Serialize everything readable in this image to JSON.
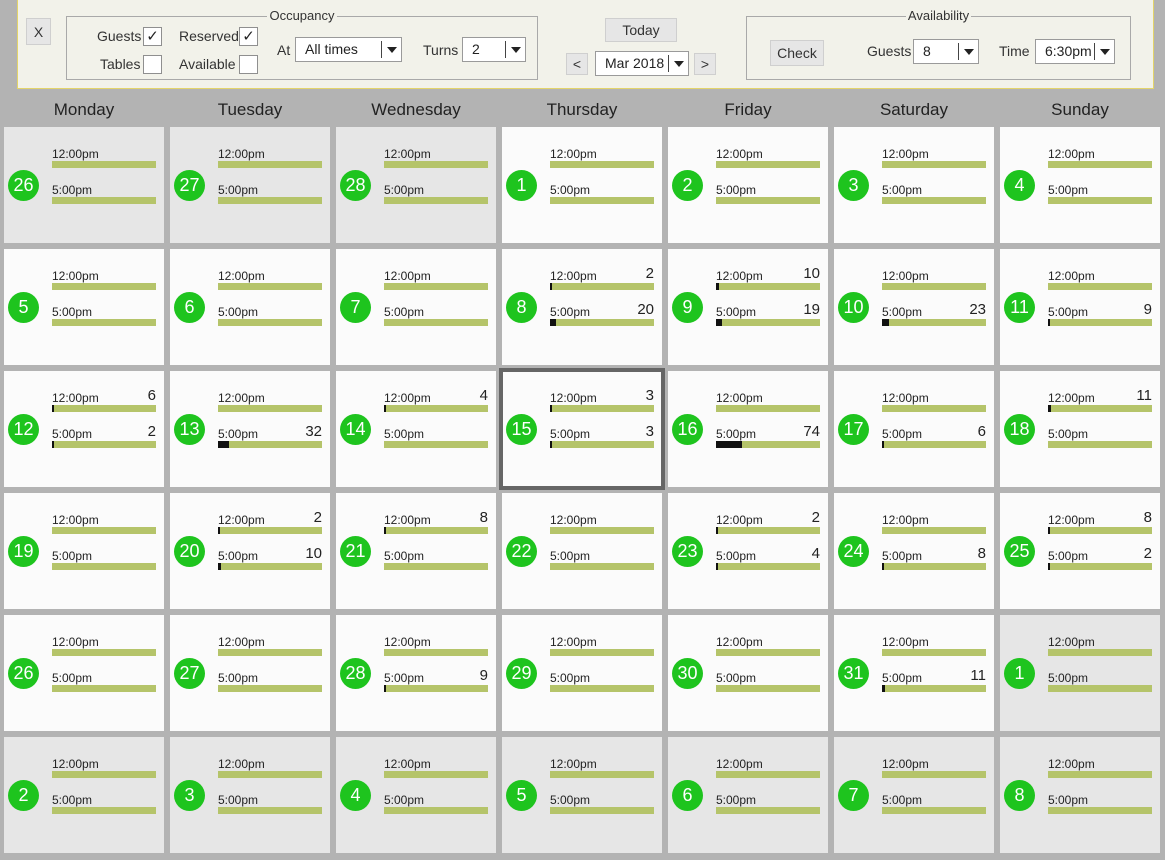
{
  "toolbar": {
    "close_label": "X",
    "occupancy": {
      "title": "Occupancy",
      "guests_label": "Guests",
      "guests_checked": "✓",
      "reserved_label": "Reserved",
      "reserved_checked": "✓",
      "tables_label": "Tables",
      "tables_checked": "",
      "available_label": "Available",
      "available_checked": "",
      "at_label": "At",
      "at_value": "All times",
      "turns_label": "Turns",
      "turns_value": "2"
    },
    "nav": {
      "today_label": "Today",
      "prev_label": "<",
      "next_label": ">",
      "month_value": "Mar 2018"
    },
    "availability": {
      "title": "Availability",
      "check_label": "Check",
      "guests_label": "Guests",
      "guests_value": "8",
      "time_label": "Time",
      "time_value": "6:30pm"
    }
  },
  "calendar": {
    "weekdays": [
      "Monday",
      "Tuesday",
      "Wednesday",
      "Thursday",
      "Friday",
      "Saturday",
      "Sunday"
    ],
    "slot_labels": [
      "12:00pm",
      "5:00pm"
    ],
    "selected_day": "15",
    "weeks": [
      [
        {
          "day": "26",
          "muted": true,
          "slots": [
            {
              "count": "",
              "fill": 0
            },
            {
              "count": "",
              "fill": 0
            }
          ]
        },
        {
          "day": "27",
          "muted": true,
          "slots": [
            {
              "count": "",
              "fill": 0
            },
            {
              "count": "",
              "fill": 0
            }
          ]
        },
        {
          "day": "28",
          "muted": true,
          "slots": [
            {
              "count": "",
              "fill": 0
            },
            {
              "count": "",
              "fill": 0
            }
          ]
        },
        {
          "day": "1",
          "muted": false,
          "slots": [
            {
              "count": "",
              "fill": 0
            },
            {
              "count": "",
              "fill": 0
            }
          ]
        },
        {
          "day": "2",
          "muted": false,
          "slots": [
            {
              "count": "",
              "fill": 0
            },
            {
              "count": "",
              "fill": 0
            }
          ]
        },
        {
          "day": "3",
          "muted": false,
          "slots": [
            {
              "count": "",
              "fill": 0
            },
            {
              "count": "",
              "fill": 0
            }
          ]
        },
        {
          "day": "4",
          "muted": false,
          "slots": [
            {
              "count": "",
              "fill": 0
            },
            {
              "count": "",
              "fill": 0
            }
          ]
        }
      ],
      [
        {
          "day": "5",
          "muted": false,
          "slots": [
            {
              "count": "",
              "fill": 0
            },
            {
              "count": "",
              "fill": 0
            }
          ]
        },
        {
          "day": "6",
          "muted": false,
          "slots": [
            {
              "count": "",
              "fill": 0
            },
            {
              "count": "",
              "fill": 0
            }
          ]
        },
        {
          "day": "7",
          "muted": false,
          "slots": [
            {
              "count": "",
              "fill": 0
            },
            {
              "count": "",
              "fill": 0
            }
          ]
        },
        {
          "day": "8",
          "muted": false,
          "slots": [
            {
              "count": "2",
              "fill": 0.01
            },
            {
              "count": "20",
              "fill": 0.06
            }
          ]
        },
        {
          "day": "9",
          "muted": false,
          "slots": [
            {
              "count": "10",
              "fill": 0.03
            },
            {
              "count": "19",
              "fill": 0.06
            }
          ]
        },
        {
          "day": "10",
          "muted": false,
          "slots": [
            {
              "count": "",
              "fill": 0
            },
            {
              "count": "23",
              "fill": 0.07
            }
          ]
        },
        {
          "day": "11",
          "muted": false,
          "slots": [
            {
              "count": "",
              "fill": 0
            },
            {
              "count": "9",
              "fill": 0.02
            }
          ]
        }
      ],
      [
        {
          "day": "12",
          "muted": false,
          "slots": [
            {
              "count": "6",
              "fill": 0.02
            },
            {
              "count": "2",
              "fill": 0.01
            }
          ]
        },
        {
          "day": "13",
          "muted": false,
          "slots": [
            {
              "count": "",
              "fill": 0
            },
            {
              "count": "32",
              "fill": 0.11
            }
          ]
        },
        {
          "day": "14",
          "muted": false,
          "slots": [
            {
              "count": "4",
              "fill": 0.01
            },
            {
              "count": "",
              "fill": 0
            }
          ]
        },
        {
          "day": "15",
          "muted": false,
          "slots": [
            {
              "count": "3",
              "fill": 0.01
            },
            {
              "count": "3",
              "fill": 0.01
            }
          ]
        },
        {
          "day": "16",
          "muted": false,
          "slots": [
            {
              "count": "",
              "fill": 0
            },
            {
              "count": "74",
              "fill": 0.25
            }
          ]
        },
        {
          "day": "17",
          "muted": false,
          "slots": [
            {
              "count": "",
              "fill": 0
            },
            {
              "count": "6",
              "fill": 0.02
            }
          ]
        },
        {
          "day": "18",
          "muted": false,
          "slots": [
            {
              "count": "11",
              "fill": 0.03
            },
            {
              "count": "",
              "fill": 0
            }
          ]
        }
      ],
      [
        {
          "day": "19",
          "muted": false,
          "slots": [
            {
              "count": "",
              "fill": 0
            },
            {
              "count": "",
              "fill": 0
            }
          ]
        },
        {
          "day": "20",
          "muted": false,
          "slots": [
            {
              "count": "2",
              "fill": 0.01
            },
            {
              "count": "10",
              "fill": 0.03
            }
          ]
        },
        {
          "day": "21",
          "muted": false,
          "slots": [
            {
              "count": "8",
              "fill": 0.02
            },
            {
              "count": "",
              "fill": 0
            }
          ]
        },
        {
          "day": "22",
          "muted": false,
          "slots": [
            {
              "count": "",
              "fill": 0
            },
            {
              "count": "",
              "fill": 0
            }
          ]
        },
        {
          "day": "23",
          "muted": false,
          "slots": [
            {
              "count": "2",
              "fill": 0.01
            },
            {
              "count": "4",
              "fill": 0.01
            }
          ]
        },
        {
          "day": "24",
          "muted": false,
          "slots": [
            {
              "count": "",
              "fill": 0
            },
            {
              "count": "8",
              "fill": 0.02
            }
          ]
        },
        {
          "day": "25",
          "muted": false,
          "slots": [
            {
              "count": "8",
              "fill": 0.02
            },
            {
              "count": "2",
              "fill": 0.01
            }
          ]
        }
      ],
      [
        {
          "day": "26",
          "muted": false,
          "slots": [
            {
              "count": "",
              "fill": 0
            },
            {
              "count": "",
              "fill": 0
            }
          ]
        },
        {
          "day": "27",
          "muted": false,
          "slots": [
            {
              "count": "",
              "fill": 0
            },
            {
              "count": "",
              "fill": 0
            }
          ]
        },
        {
          "day": "28",
          "muted": false,
          "slots": [
            {
              "count": "",
              "fill": 0
            },
            {
              "count": "9",
              "fill": 0.02
            }
          ]
        },
        {
          "day": "29",
          "muted": false,
          "slots": [
            {
              "count": "",
              "fill": 0
            },
            {
              "count": "",
              "fill": 0
            }
          ]
        },
        {
          "day": "30",
          "muted": false,
          "slots": [
            {
              "count": "",
              "fill": 0
            },
            {
              "count": "",
              "fill": 0
            }
          ]
        },
        {
          "day": "31",
          "muted": false,
          "slots": [
            {
              "count": "",
              "fill": 0
            },
            {
              "count": "11",
              "fill": 0.03
            }
          ]
        },
        {
          "day": "1",
          "muted": true,
          "slots": [
            {
              "count": "",
              "fill": 0
            },
            {
              "count": "",
              "fill": 0
            }
          ]
        }
      ],
      [
        {
          "day": "2",
          "muted": true,
          "slots": [
            {
              "count": "",
              "fill": 0
            },
            {
              "count": "",
              "fill": 0
            }
          ]
        },
        {
          "day": "3",
          "muted": true,
          "slots": [
            {
              "count": "",
              "fill": 0
            },
            {
              "count": "",
              "fill": 0
            }
          ]
        },
        {
          "day": "4",
          "muted": true,
          "slots": [
            {
              "count": "",
              "fill": 0
            },
            {
              "count": "",
              "fill": 0
            }
          ]
        },
        {
          "day": "5",
          "muted": true,
          "slots": [
            {
              "count": "",
              "fill": 0
            },
            {
              "count": "",
              "fill": 0
            }
          ]
        },
        {
          "day": "6",
          "muted": true,
          "slots": [
            {
              "count": "",
              "fill": 0
            },
            {
              "count": "",
              "fill": 0
            }
          ]
        },
        {
          "day": "7",
          "muted": true,
          "slots": [
            {
              "count": "",
              "fill": 0
            },
            {
              "count": "",
              "fill": 0
            }
          ]
        },
        {
          "day": "8",
          "muted": true,
          "slots": [
            {
              "count": "",
              "fill": 0
            },
            {
              "count": "",
              "fill": 0
            }
          ]
        }
      ]
    ]
  }
}
